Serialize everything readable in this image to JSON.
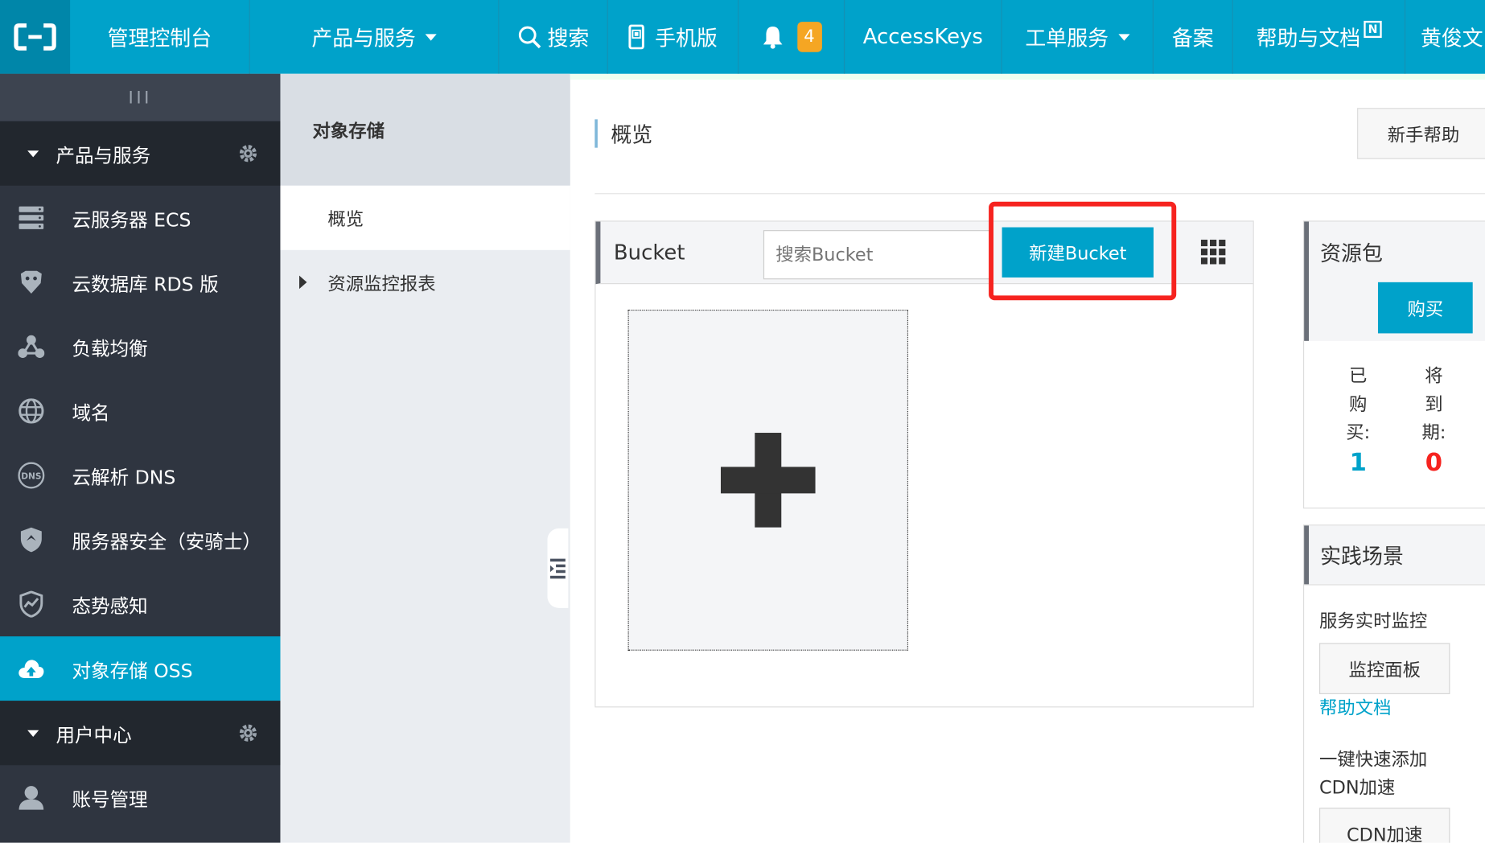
{
  "topbar": {
    "console": "管理控制台",
    "products": "产品与服务",
    "search": "搜索",
    "mobile": "手机版",
    "notifications_count": "4",
    "accesskeys": "AccessKeys",
    "tickets": "工单服务",
    "beian": "备案",
    "help_docs": "帮助与文档",
    "help_docs_new_badge": "N",
    "user": "黄俊文"
  },
  "sidebar": {
    "collapse_label": "III",
    "group_products": "产品与服务",
    "items": [
      {
        "label": "云服务器 ECS",
        "icon": "server-icon"
      },
      {
        "label": "云数据库 RDS 版",
        "icon": "database-icon"
      },
      {
        "label": "负载均衡",
        "icon": "load-balance-icon"
      },
      {
        "label": "域名",
        "icon": "globe-icon"
      },
      {
        "label": "云解析 DNS",
        "icon": "dns-icon"
      },
      {
        "label": "服务器安全（安骑士）",
        "icon": "shield-icon"
      },
      {
        "label": "态势感知",
        "icon": "trend-shield-icon"
      },
      {
        "label": "对象存储 OSS",
        "icon": "cloud-upload-icon",
        "active": true
      }
    ],
    "group_user": "用户中心",
    "account": "账号管理"
  },
  "subnav": {
    "title": "对象存储",
    "overview": "概览",
    "monitor_report": "资源监控报表"
  },
  "main": {
    "title": "概览",
    "help_button": "新手帮助",
    "bucket": {
      "title": "Bucket",
      "search_placeholder": "搜索Bucket",
      "new_button": "新建Bucket"
    }
  },
  "resource_pack": {
    "title": "资源包",
    "buy": "购买",
    "purchased_label": [
      "已",
      "购",
      "买:"
    ],
    "purchased_value": "1",
    "expiring_label": [
      "将",
      "到",
      "期:"
    ],
    "expiring_value": "0"
  },
  "practice": {
    "title": "实践场景",
    "scene1": "服务实时监控",
    "scene1_button": "监控面板",
    "scene1_link": "帮助文档",
    "scene2_line1": "一键快速添加",
    "scene2_line2": "CDN加速",
    "scene2_button": "CDN加速"
  },
  "colors": {
    "brand": "#00a2ca",
    "sidebar_bg": "#2f3540",
    "highlight_box": "#f6231f",
    "expiring_value": "#f6231f",
    "purchased_value": "#00a2ca"
  }
}
